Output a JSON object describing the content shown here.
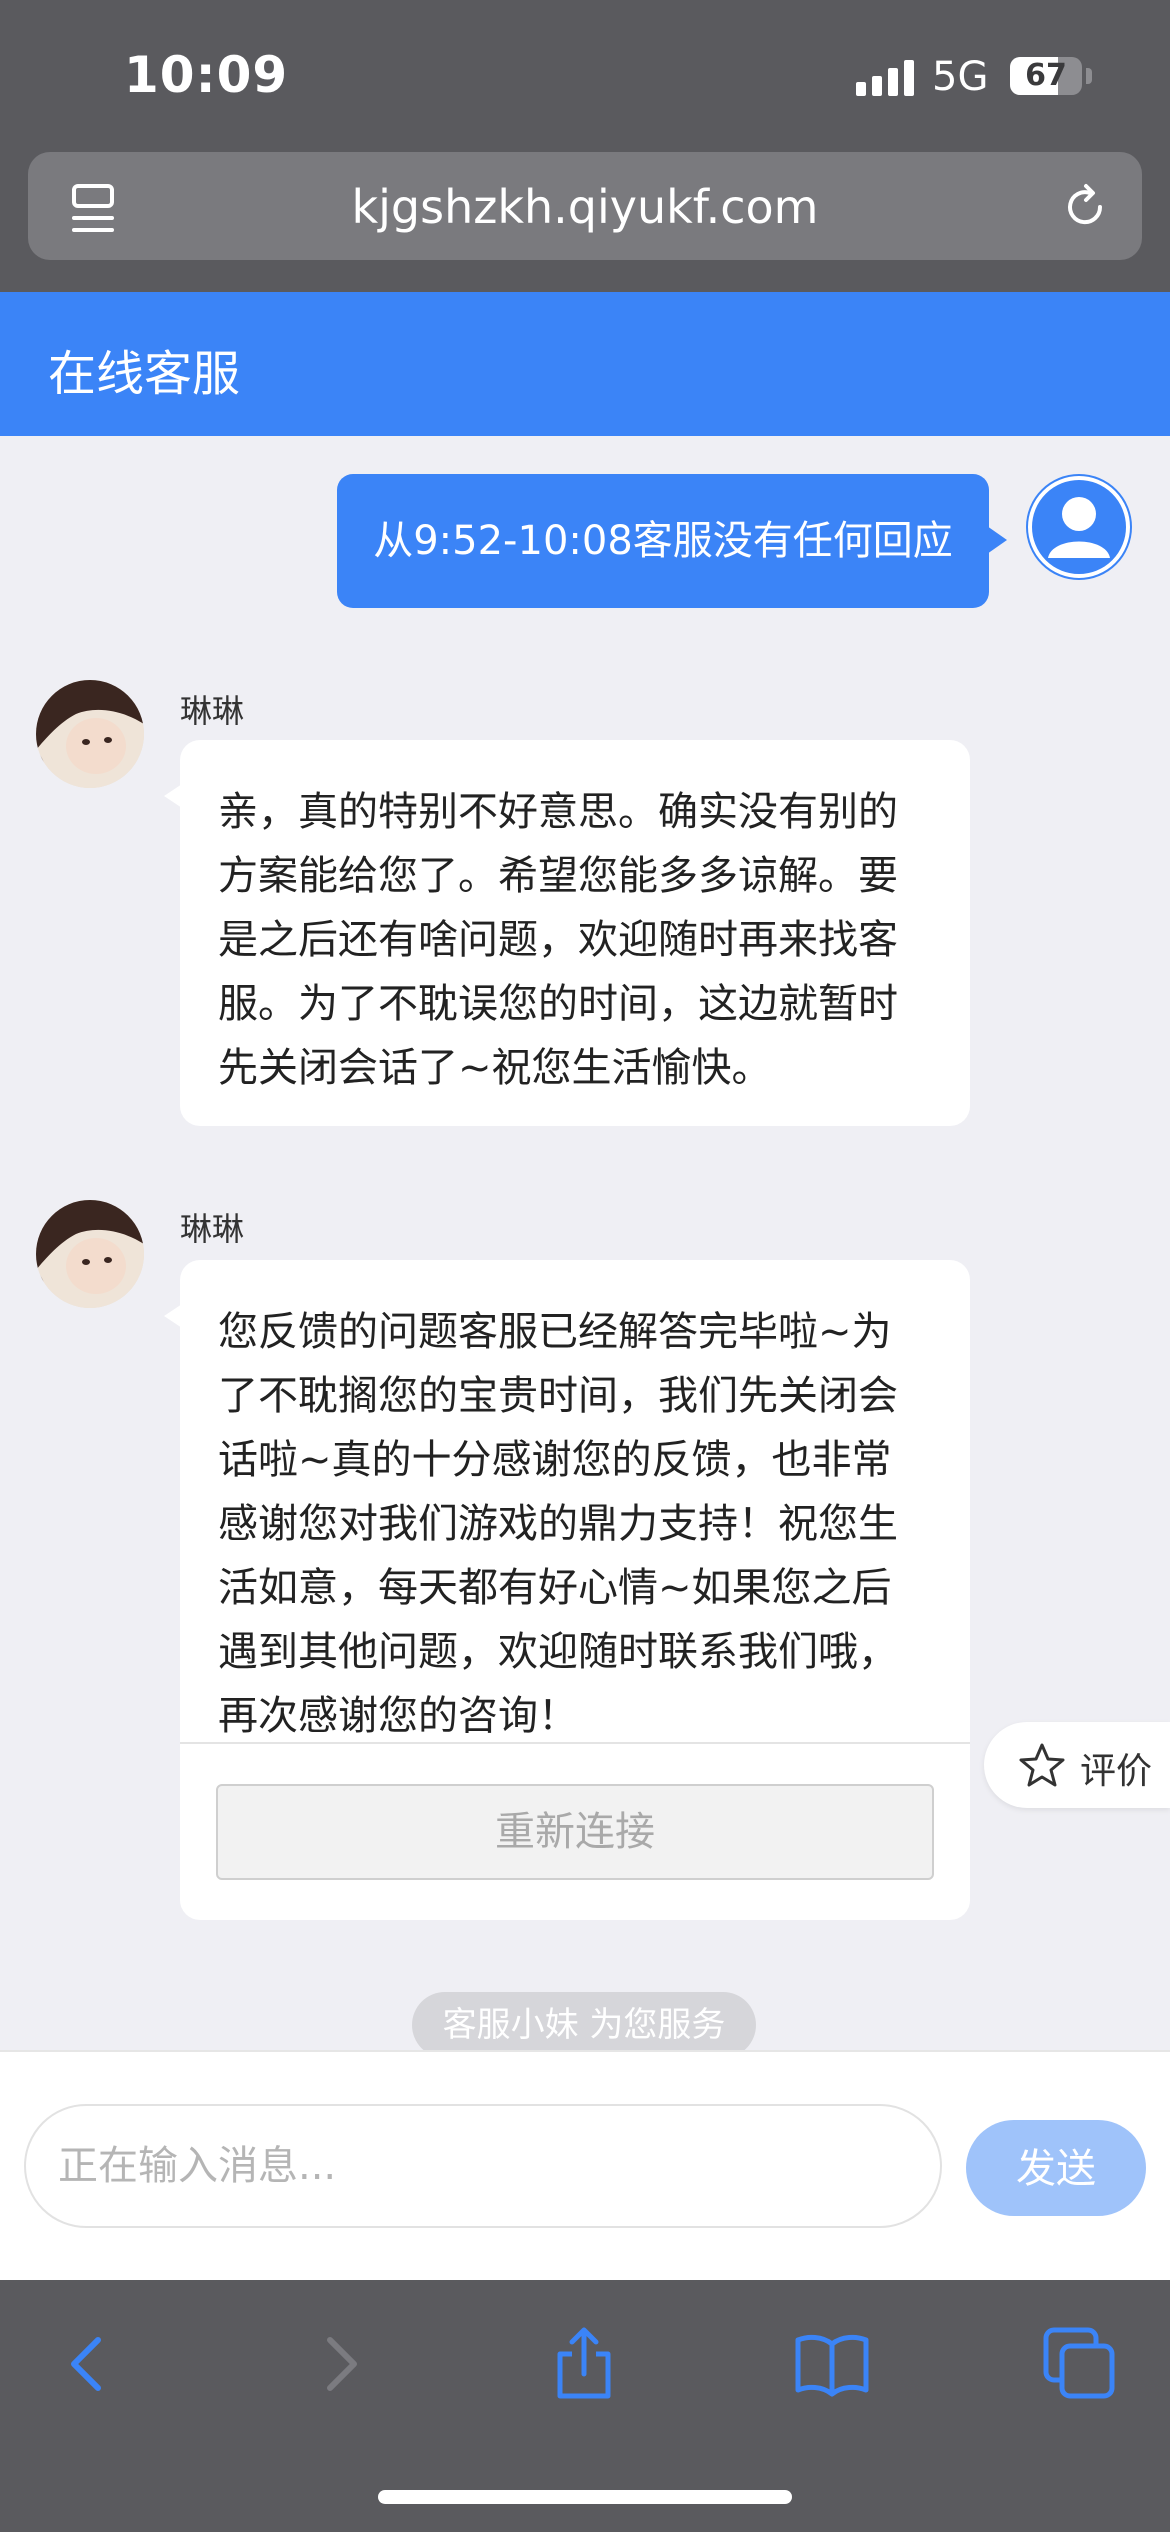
{
  "status_bar": {
    "time": "10:09",
    "network": "5G",
    "battery": "67",
    "battery_level_percent": 67
  },
  "browser": {
    "url": "kjgshzkh.qiyukf.com"
  },
  "header": {
    "title": "在线客服"
  },
  "messages": {
    "user": {
      "text": "从9:52-10:08客服没有任何回应"
    },
    "agent1": {
      "name": "琳琳",
      "lines": [
        "亲，真的特别不好意思。确实没有别的",
        "方案能给您了。希望您能多多谅解。要",
        "是之后还有啥问题，欢迎随时再来找客",
        "服。为了不耽误您的时间，这边就暂时",
        "先关闭会话了~祝您生活愉快。"
      ]
    },
    "agent2": {
      "name": "琳琳",
      "lines": [
        "您反馈的问题客服已经解答完毕啦~为",
        "了不耽搁您的宝贵时间，我们先关闭会",
        "话啦~真的十分感谢您的反馈，也非常",
        "感谢您对我们游戏的鼎力支持！祝您生",
        "活如意，每天都有好心情~如果您之后",
        "遇到其他问题，欢迎随时联系我们哦，",
        "再次感谢您的咨询！"
      ],
      "reconnect_label": "重新连接"
    }
  },
  "rate": {
    "label": "评价"
  },
  "service_banner": "客服小妹 为您服务",
  "composer": {
    "placeholder": "正在输入消息...",
    "send_label": "发送"
  },
  "colors": {
    "accent": "#3b84f7",
    "send_disabled": "#9fc3fa",
    "chrome": "#5a5a5e",
    "chat_bg": "#efeff4"
  },
  "toolbar": {
    "icons": [
      "back-icon",
      "forward-icon",
      "share-icon",
      "bookmarks-icon",
      "tabs-icon"
    ]
  }
}
